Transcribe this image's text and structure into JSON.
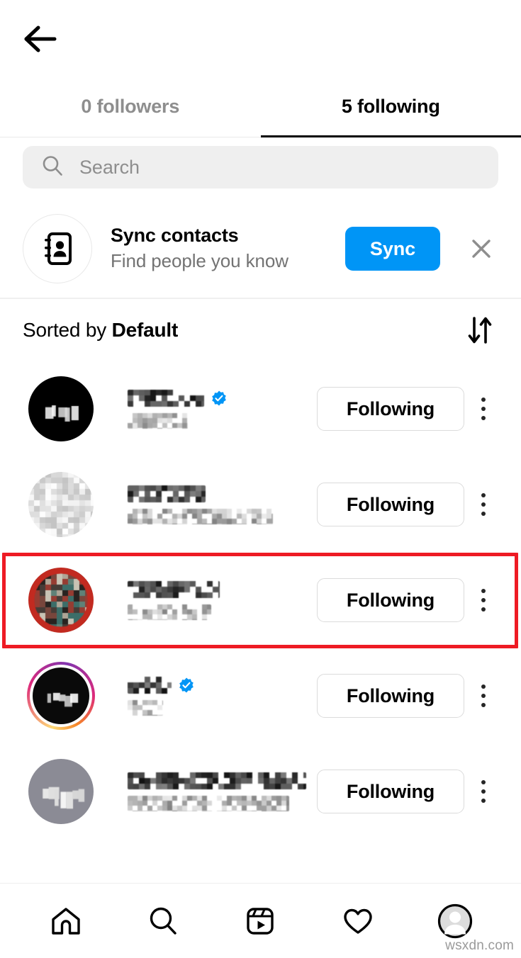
{
  "header": {
    "back_icon": "back-arrow-icon"
  },
  "tabs": [
    {
      "label": "0 followers",
      "active": false
    },
    {
      "label": "5 following",
      "active": true
    }
  ],
  "search": {
    "placeholder": "Search",
    "value": "",
    "icon": "search-icon"
  },
  "sync_contacts": {
    "icon": "contact-book-icon",
    "title": "Sync contacts",
    "subtitle": "Find people you know",
    "button_label": "Sync",
    "close_icon": "close-icon",
    "button_color": "#0095f6"
  },
  "sort": {
    "prefix": "Sorted by ",
    "value": "Default",
    "icon": "sort-arrows-icon"
  },
  "list": {
    "follow_button_label": "Following",
    "menu_icon": "kebab-menu-icon",
    "rows": [
      {
        "avatar_kind": "solid-black",
        "avatar_color": "#000000",
        "has_story_ring": false,
        "verified": true,
        "username_redacted": true,
        "fullname_redacted": true,
        "username_width": 108,
        "fullname_width": 85,
        "button_label": "Following",
        "highlighted": false
      },
      {
        "avatar_kind": "light-noise",
        "avatar_color": "#e9e9e9",
        "has_story_ring": false,
        "verified": false,
        "username_redacted": true,
        "fullname_redacted": true,
        "username_width": 110,
        "fullname_width": 205,
        "button_label": "Following",
        "highlighted": false
      },
      {
        "avatar_kind": "photo-teal-red",
        "avatar_color": "#7d7b6e",
        "has_story_ring": false,
        "verified": false,
        "username_redacted": true,
        "fullname_redacted": true,
        "username_width": 130,
        "fullname_width": 118,
        "button_label": "Following",
        "highlighted": true
      },
      {
        "avatar_kind": "solid-black",
        "avatar_color": "#0a0a0a",
        "has_story_ring": true,
        "verified": true,
        "username_redacted": true,
        "fullname_redacted": true,
        "username_width": 62,
        "fullname_width": 50,
        "button_label": "Following",
        "highlighted": false
      },
      {
        "avatar_kind": "solid-gray",
        "avatar_color": "#8b8b95",
        "has_story_ring": false,
        "verified": false,
        "username_redacted": true,
        "fullname_redacted": true,
        "username_width": 252,
        "fullname_width": 228,
        "button_label": "Following",
        "highlighted": false
      }
    ]
  },
  "highlight": {
    "color": "#ee1b24",
    "target_row_index": 2
  },
  "bottom_nav": [
    {
      "icon": "home-icon",
      "active": false
    },
    {
      "icon": "search-icon",
      "active": false
    },
    {
      "icon": "reels-icon",
      "active": false
    },
    {
      "icon": "heart-icon",
      "active": false
    },
    {
      "icon": "profile-avatar-icon",
      "active": true
    }
  ],
  "watermark": "wsxdn.com"
}
